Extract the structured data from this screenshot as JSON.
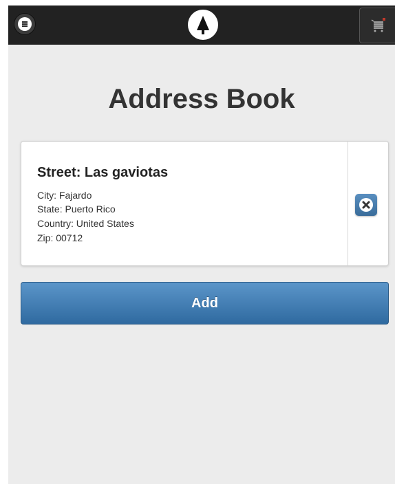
{
  "header": {
    "menu_icon": "menu-icon",
    "logo_icon": "tree-logo-icon",
    "cart_icon": "cart-icon"
  },
  "page": {
    "title": "Address Book"
  },
  "addresses": [
    {
      "street": "Street: Las gaviotas",
      "city": "City: Fajardo",
      "state": "State: Puerto Rico",
      "country": "Country: United States",
      "zip": "Zip: 00712"
    }
  ],
  "actions": {
    "add_label": "Add"
  },
  "colors": {
    "header_bg": "#222222",
    "page_bg": "#ececec",
    "accent_blue": "#3f7cb4",
    "title_text": "#333333"
  }
}
